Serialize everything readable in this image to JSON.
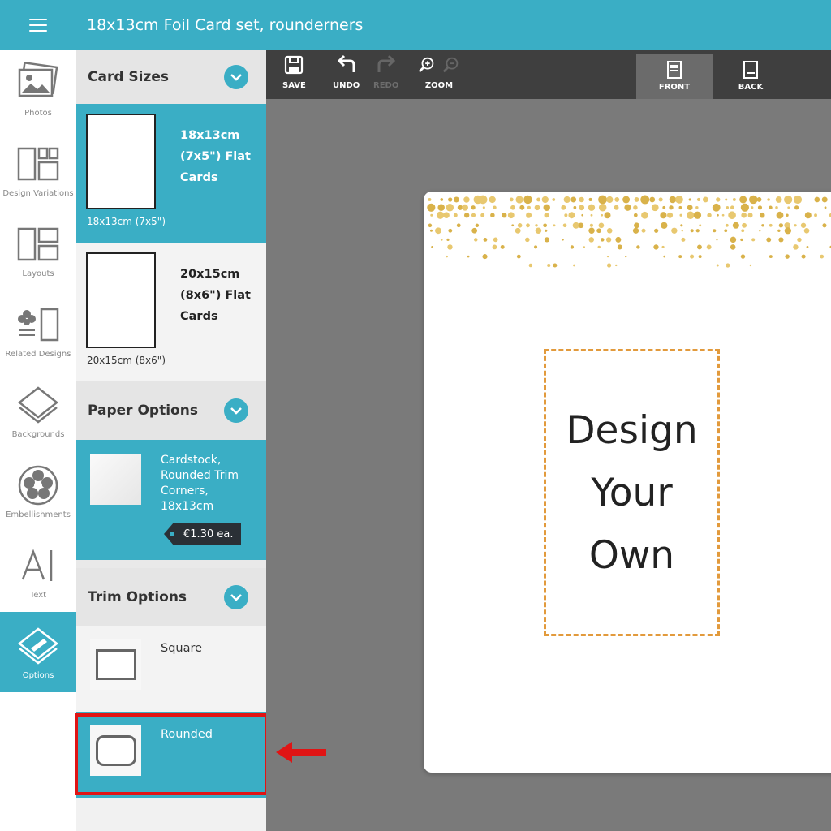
{
  "app": {
    "title": "18x13cm Foil Card set, rounderners"
  },
  "rail": {
    "items": [
      {
        "label": "Photos",
        "icon": "photos-icon"
      },
      {
        "label": "Design Variations",
        "icon": "design-variations-icon"
      },
      {
        "label": "Layouts",
        "icon": "layouts-icon"
      },
      {
        "label": "Related Designs",
        "icon": "related-designs-icon"
      },
      {
        "label": "Backgrounds",
        "icon": "backgrounds-icon"
      },
      {
        "label": "Embellishments",
        "icon": "embellishments-icon"
      },
      {
        "label": "Text",
        "icon": "text-icon"
      },
      {
        "label": "Options",
        "icon": "options-icon"
      }
    ],
    "active": "Options"
  },
  "panel": {
    "card_sizes": {
      "title": "Card Sizes",
      "items": [
        {
          "title": "18x13cm (7x5\") Flat Cards",
          "caption": "18x13cm (7x5\")",
          "selected": true
        },
        {
          "title": "20x15cm (8x6\") Flat Cards",
          "caption": "20x15cm (8x6\")",
          "selected": false
        }
      ]
    },
    "paper_options": {
      "title": "Paper Options",
      "item": {
        "description": "Cardstock, Rounded Trim Corners, 18x13cm",
        "price": "€1.30 ea."
      }
    },
    "trim_options": {
      "title": "Trim Options",
      "items": [
        {
          "label": "Square",
          "selected": false
        },
        {
          "label": "Rounded",
          "selected": true
        }
      ]
    }
  },
  "toolbar": {
    "save": "SAVE",
    "undo": "UNDO",
    "redo": "REDO",
    "zoom": "ZOOM",
    "front": "FRONT",
    "back": "BACK"
  },
  "canvas": {
    "design_text": [
      "Design",
      "Your",
      "Own"
    ],
    "colors": {
      "accent": "#3aaec5",
      "gold": "#d9b24a",
      "frame": "#e29a3c",
      "highlight": "#e01414"
    }
  }
}
